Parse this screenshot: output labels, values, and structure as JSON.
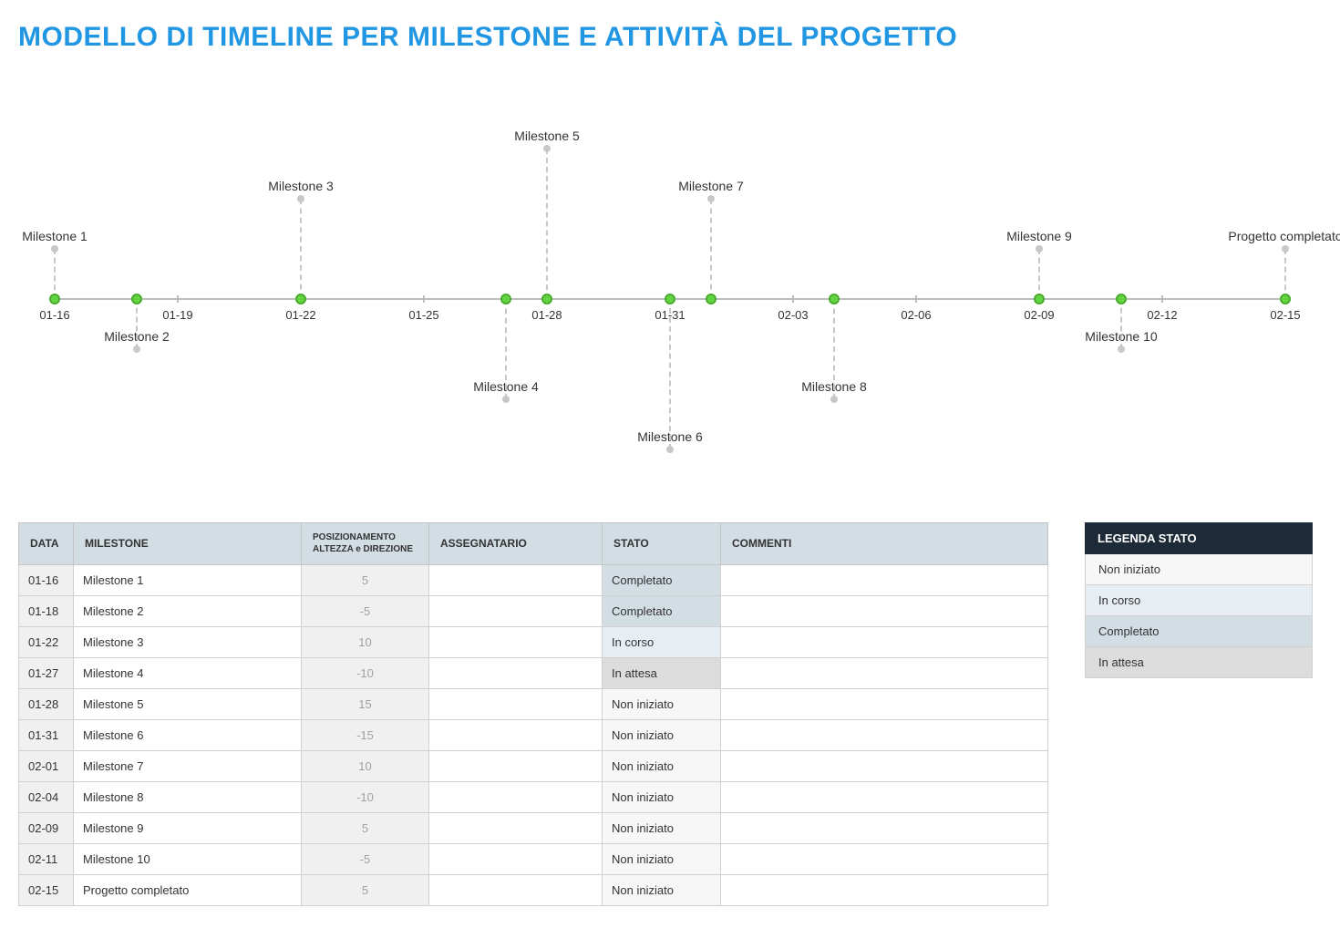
{
  "title": "MODELLO DI TIMELINE PER MILESTONE E ATTIVITÀ DEL PROGETTO",
  "axis": {
    "ticks": [
      "01-16",
      "01-19",
      "01-22",
      "01-25",
      "01-28",
      "01-31",
      "02-03",
      "02-06",
      "02-09",
      "02-12",
      "02-15"
    ]
  },
  "table": {
    "headers": {
      "date": "DATA",
      "milestone": "MILESTONE",
      "position": "POSIZIONAMENTO ALTEZZA e DIREZIONE",
      "assignee": "ASSEGNATARIO",
      "status": "STATO",
      "comments": "COMMENTI"
    },
    "rows": [
      {
        "date": "01-16",
        "name": "Milestone 1",
        "pos": "5",
        "assignee": "",
        "status": "Completato",
        "status_key": "completato",
        "comments": ""
      },
      {
        "date": "01-18",
        "name": "Milestone 2",
        "pos": "-5",
        "assignee": "",
        "status": "Completato",
        "status_key": "completato",
        "comments": ""
      },
      {
        "date": "01-22",
        "name": "Milestone 3",
        "pos": "10",
        "assignee": "",
        "status": "In corso",
        "status_key": "in-corso",
        "comments": ""
      },
      {
        "date": "01-27",
        "name": "Milestone 4",
        "pos": "-10",
        "assignee": "",
        "status": "In attesa",
        "status_key": "in-attesa",
        "comments": ""
      },
      {
        "date": "01-28",
        "name": "Milestone 5",
        "pos": "15",
        "assignee": "",
        "status": "Non iniziato",
        "status_key": "non-iniziato",
        "comments": ""
      },
      {
        "date": "01-31",
        "name": "Milestone 6",
        "pos": "-15",
        "assignee": "",
        "status": "Non iniziato",
        "status_key": "non-iniziato",
        "comments": ""
      },
      {
        "date": "02-01",
        "name": "Milestone 7",
        "pos": "10",
        "assignee": "",
        "status": "Non iniziato",
        "status_key": "non-iniziato",
        "comments": ""
      },
      {
        "date": "02-04",
        "name": "Milestone 8",
        "pos": "-10",
        "assignee": "",
        "status": "Non iniziato",
        "status_key": "non-iniziato",
        "comments": ""
      },
      {
        "date": "02-09",
        "name": "Milestone 9",
        "pos": "5",
        "assignee": "",
        "status": "Non iniziato",
        "status_key": "non-iniziato",
        "comments": ""
      },
      {
        "date": "02-11",
        "name": "Milestone 10",
        "pos": "-5",
        "assignee": "",
        "status": "Non iniziato",
        "status_key": "non-iniziato",
        "comments": ""
      },
      {
        "date": "02-15",
        "name": "Progetto completato",
        "pos": "5",
        "assignee": "",
        "status": "Non iniziato",
        "status_key": "non-iniziato",
        "comments": ""
      }
    ]
  },
  "legend": {
    "title": "LEGENDA STATO",
    "items": [
      {
        "label": "Non iniziato",
        "key": "non-iniziato"
      },
      {
        "label": "In corso",
        "key": "in-corso"
      },
      {
        "label": "Completato",
        "key": "completato"
      },
      {
        "label": "In attesa",
        "key": "in-attesa"
      }
    ]
  },
  "chart_data": {
    "type": "scatter",
    "title": "",
    "xlabel": "",
    "ylabel": "",
    "x_type": "date",
    "x_range": [
      "01-16",
      "02-15"
    ],
    "y_range": [
      -15,
      15
    ],
    "series": [
      {
        "name": "Milestones",
        "points": [
          {
            "x": "01-16",
            "y": 5,
            "label": "Milestone 1"
          },
          {
            "x": "01-18",
            "y": -5,
            "label": "Milestone 2"
          },
          {
            "x": "01-22",
            "y": 10,
            "label": "Milestone 3"
          },
          {
            "x": "01-27",
            "y": -10,
            "label": "Milestone 4"
          },
          {
            "x": "01-28",
            "y": 15,
            "label": "Milestone 5"
          },
          {
            "x": "01-31",
            "y": -15,
            "label": "Milestone 6"
          },
          {
            "x": "02-01",
            "y": 10,
            "label": "Milestone 7"
          },
          {
            "x": "02-04",
            "y": -10,
            "label": "Milestone 8"
          },
          {
            "x": "02-09",
            "y": 5,
            "label": "Milestone 9"
          },
          {
            "x": "02-11",
            "y": -5,
            "label": "Milestone 10"
          },
          {
            "x": "02-15",
            "y": 5,
            "label": "Progetto completato"
          }
        ]
      }
    ]
  }
}
